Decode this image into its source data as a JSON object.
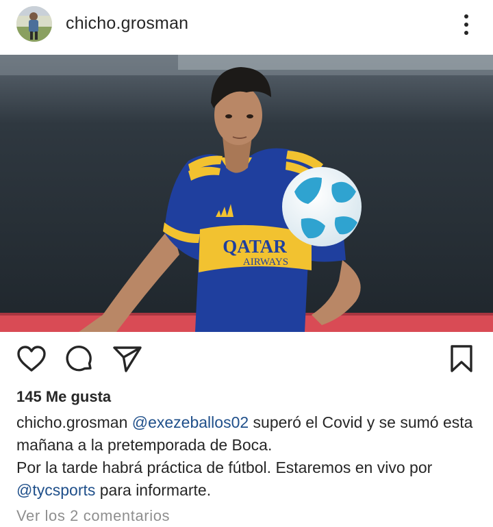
{
  "post": {
    "username": "chicho.grosman",
    "likes_text": "145 Me gusta",
    "caption": {
      "username": "chicho.grosman",
      "mention_1": "@exezeballos02",
      "text_1": " superó el Covid y se sumó esta mañana a la pretemporada de Boca.",
      "text_2": "Por la tarde habrá práctica de fútbol. Estaremos en vivo por ",
      "mention_2": "@tycsports",
      "text_3": " para informarte."
    },
    "view_comments": "Ver los 2 comentarios",
    "photo": {
      "shirt_text_line1": "QATAR",
      "shirt_text_line2": "AIRWAYS",
      "kit_blue": "#1f3f9e",
      "kit_yellow": "#f2c230"
    }
  },
  "icons": {
    "more": "more-vertical-icon",
    "like": "heart-icon",
    "comment": "comment-icon",
    "share": "send-icon",
    "save": "bookmark-icon"
  }
}
